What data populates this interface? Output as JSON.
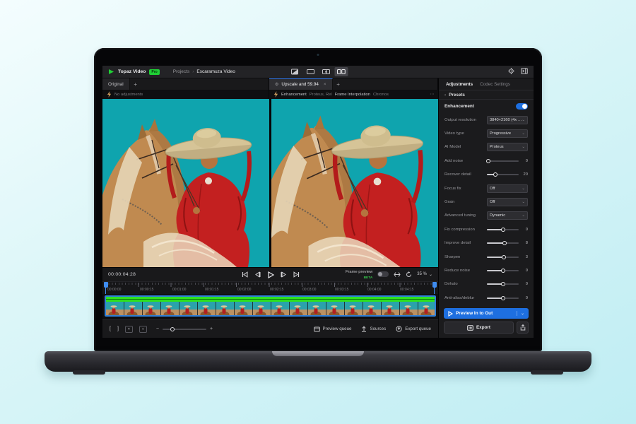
{
  "window": {
    "brand": "Topaz Video",
    "brand_badge": "Pro",
    "breadcrumb": {
      "root": "Projects",
      "separator": "›",
      "current": "Escaramuza Video"
    }
  },
  "icons": {
    "plus": "+",
    "close": "×",
    "overflow": "⋯",
    "chevron_down": "⌄",
    "chevron_right": "›",
    "minus": "−",
    "bracket_in": "[",
    "bracket_out": "]",
    "clear": "×",
    "loop": "○",
    "gear": "⚙"
  },
  "panes": {
    "left": {
      "tab": "Original",
      "info": "No adjustments"
    },
    "right": {
      "tab": "Upscale and 59.94",
      "info": {
        "enhancement_label": "Enhancement",
        "enhancement_value": "Proteus, Rel",
        "interpolation_label": "Frame Interpolation",
        "interpolation_value": "Chronos"
      }
    }
  },
  "transport": {
    "timecode": "00:00:04:28",
    "frame_preview_label": "Frame preview",
    "beta_badge": "BETA",
    "zoom_value": "35 %"
  },
  "timeline": {
    "ruler_labels": [
      "00:00:00",
      "00:00:15",
      "00:01:00",
      "00:01:15",
      "00:02:00",
      "00:02:15",
      "00:03:00",
      "00:03:15",
      "00:04:00",
      "00:04:15"
    ]
  },
  "bottom_bar": {
    "preview_queue": "Preview queue",
    "sources": "Sources",
    "export_queue": "Export queue"
  },
  "sidebar": {
    "tabs": [
      "Adjustments",
      "Codec Settings"
    ],
    "presets_label": "Presets",
    "enhancement_label": "Enhancement",
    "rows": [
      {
        "label": "Output resolution",
        "value": "3840×2160 (4x …"
      },
      {
        "label": "Video type",
        "value": "Progressive"
      },
      {
        "label": "AI Model",
        "value": "Proteus"
      },
      {
        "label": "Add noise",
        "value": "0"
      },
      {
        "label": "Recover detail",
        "value": "20"
      },
      {
        "label": "Focus fix",
        "value": "Off"
      },
      {
        "label": "Grain",
        "value": "Off"
      },
      {
        "label": "Advanced tuning",
        "value": "Dynamic"
      },
      {
        "label": "Fix compression",
        "value": "0"
      },
      {
        "label": "Improve detail",
        "value": "8"
      },
      {
        "label": "Sharpen",
        "value": "3"
      },
      {
        "label": "Reduce noise",
        "value": "0"
      },
      {
        "label": "Dehalo",
        "value": "0"
      },
      {
        "label": "Anti-alias/deblur",
        "value": "0"
      }
    ],
    "preview_button": "Preview In to Out",
    "export_button": "Export"
  },
  "colors": {
    "accent_blue": "#1e6fe0",
    "brand_green": "#1fd035",
    "beta_green": "#35c24a",
    "render_green": "#2ee01e",
    "preview_teal": "#0fa4ae",
    "selection_blue": "#2f7fd8"
  }
}
